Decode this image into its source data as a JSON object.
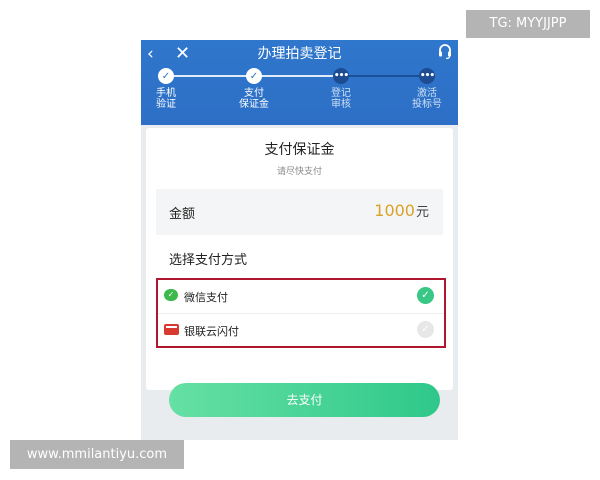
{
  "header": {
    "back_glyph": "‹",
    "close_glyph": "✕",
    "help_glyph": "🎧",
    "title": "办理拍卖登记"
  },
  "steps": [
    {
      "label": "手机\n验证",
      "state": "done",
      "glyph": "✓"
    },
    {
      "label": "支付\n保证金",
      "state": "done",
      "glyph": "✓"
    },
    {
      "label": "登记\n审核",
      "state": "pending",
      "glyph": "•••"
    },
    {
      "label": "激活\n投标号",
      "state": "pending",
      "glyph": "•••"
    }
  ],
  "card": {
    "title": "支付保证金",
    "subtitle": "请尽快支付",
    "amount_label": "金额",
    "amount_value": "1000",
    "amount_unit": "元",
    "method_heading": "选择支付方式"
  },
  "payment_methods": [
    {
      "label": "微信支付",
      "icon": "wechat-icon",
      "selected": true
    },
    {
      "label": "银联云闪付",
      "icon": "unionpay-icon",
      "selected": false
    }
  ],
  "pay_button": "去支付",
  "watermarks": {
    "tg": "TG: MYYJJPP",
    "url": "www.mmilantiyu.com"
  },
  "colors": {
    "header_blue": "#2f77cc",
    "amount_gold": "#d9a228",
    "selected_green": "#38c785",
    "highlight_border": "#b1162f"
  }
}
